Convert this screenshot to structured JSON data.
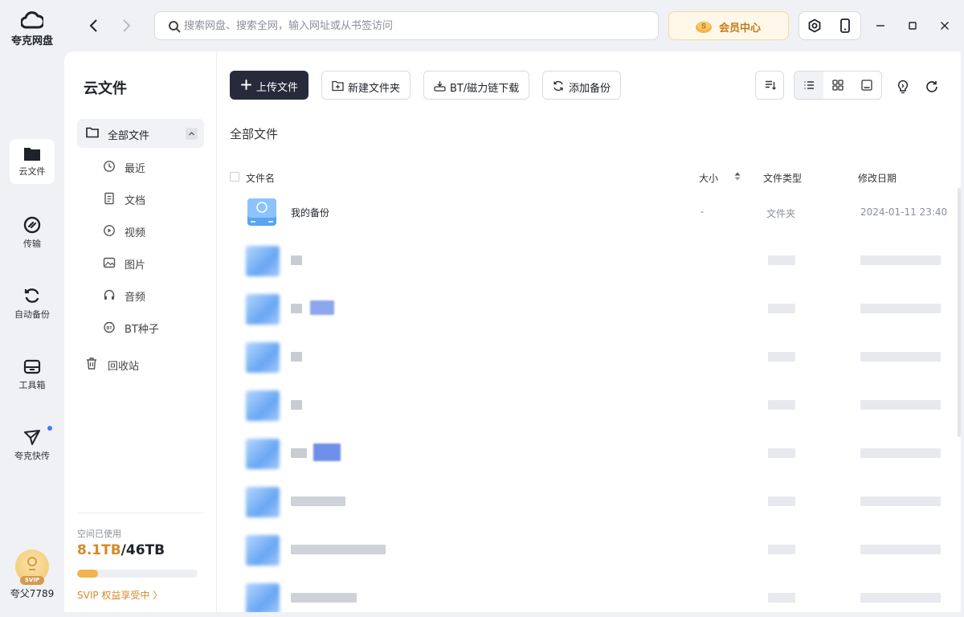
{
  "app": {
    "name": "夸克网盘",
    "user": "夸父7789",
    "badge": "SVIP"
  },
  "rail": {
    "items": [
      {
        "label": "云文件",
        "icon": "folder-icon",
        "active": true
      },
      {
        "label": "传输",
        "icon": "transfer-icon"
      },
      {
        "label": "自动备份",
        "icon": "sync-icon"
      },
      {
        "label": "工具箱",
        "icon": "toolbox-icon"
      },
      {
        "label": "夸克快传",
        "icon": "paper-plane-icon",
        "dot": true
      }
    ]
  },
  "topbar": {
    "search_placeholder": "搜索网盘、搜索全网，输入网址或从书签访问",
    "member_label": "会员中心"
  },
  "sidebar": {
    "title": "云文件",
    "all_files": "全部文件",
    "items": [
      {
        "label": "最近",
        "icon": "clock-icon"
      },
      {
        "label": "文档",
        "icon": "document-icon"
      },
      {
        "label": "视频",
        "icon": "play-icon"
      },
      {
        "label": "图片",
        "icon": "image-icon"
      },
      {
        "label": "音频",
        "icon": "headphones-icon"
      },
      {
        "label": "BT种子",
        "icon": "bt-icon"
      }
    ],
    "trash": "回收站",
    "storage": {
      "label": "空间已使用",
      "used": "8.1TB",
      "total": "/46TB",
      "used_fraction": 0.176
    },
    "svip_link": "SVIP 权益享受中 〉"
  },
  "toolbar": {
    "upload": "上传文件",
    "new_folder": "新建文件夹",
    "bt_download": "BT/磁力链下载",
    "add_backup": "添加备份"
  },
  "breadcrumb": "全部文件",
  "table": {
    "headers": {
      "name": "文件名",
      "size": "大小",
      "type": "文件类型",
      "date": "修改日期"
    },
    "rows": [
      {
        "name": "我的备份",
        "size": "-",
        "type": "文件夹",
        "date": "2024-01-11 23:40"
      }
    ]
  }
}
